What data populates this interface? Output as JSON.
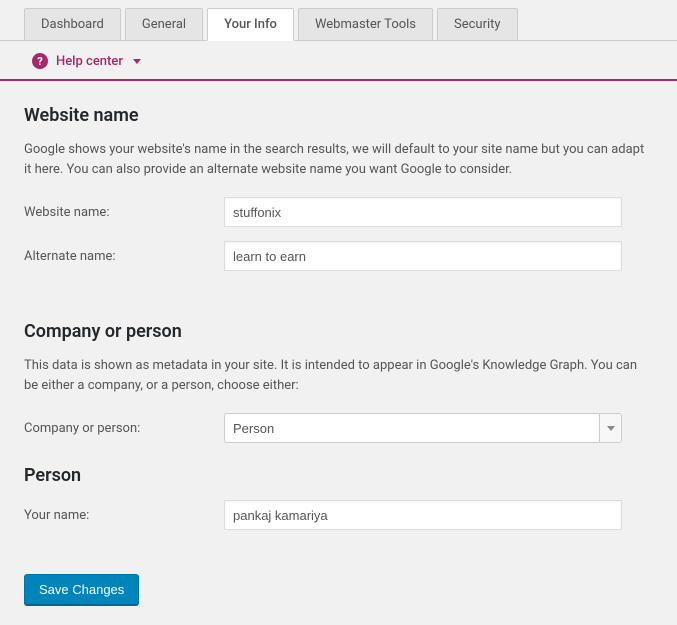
{
  "tabs": [
    {
      "label": "Dashboard"
    },
    {
      "label": "General"
    },
    {
      "label": "Your Info"
    },
    {
      "label": "Webmaster Tools"
    },
    {
      "label": "Security"
    }
  ],
  "active_tab_index": 2,
  "help_center": {
    "label": "Help center"
  },
  "sections": {
    "website_name": {
      "title": "Website name",
      "description": "Google shows your website's name in the search results, we will default to your site name but you can adapt it here. You can also provide an alternate website name you want Google to consider.",
      "website_name_label": "Website name:",
      "website_name_value": "stuffonix",
      "alternate_name_label": "Alternate name:",
      "alternate_name_value": "learn to earn"
    },
    "company_person": {
      "title": "Company or person",
      "description": "This data is shown as metadata in your site. It is intended to appear in Google's Knowledge Graph. You can be either a company, or a person, choose either:",
      "select_label": "Company or person:",
      "select_value": "Person"
    },
    "person": {
      "title": "Person",
      "your_name_label": "Your name:",
      "your_name_value": "pankaj kamariya"
    }
  },
  "save_button": "Save Changes"
}
